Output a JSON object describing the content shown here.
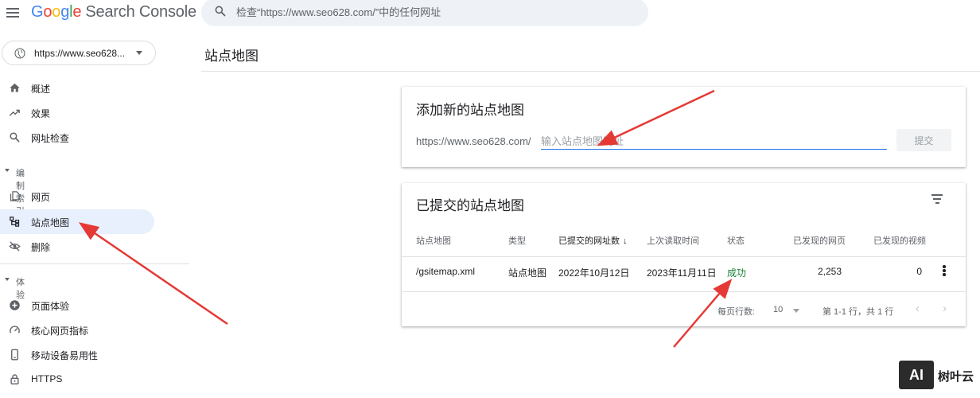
{
  "header": {
    "logo_google_letters": [
      "G",
      "o",
      "o",
      "g",
      "l",
      "e"
    ],
    "logo_product": "Search Console",
    "search_placeholder": "检查“https://www.seo628.com/”中的任何网址"
  },
  "sidebar": {
    "property": "https://www.seo628...",
    "items_top": [
      {
        "label": "概述",
        "icon": "home-icon"
      },
      {
        "label": "效果",
        "icon": "trending-up-icon"
      },
      {
        "label": "网址检查",
        "icon": "search-icon"
      }
    ],
    "section_index": "编制索引",
    "items_index": [
      {
        "label": "网页",
        "icon": "pages-icon"
      },
      {
        "label": "站点地图",
        "icon": "sitemap-icon",
        "active": true
      },
      {
        "label": "删除",
        "icon": "visibility-off-icon"
      }
    ],
    "section_experience": "体验",
    "items_experience": [
      {
        "label": "页面体验",
        "icon": "add-circle-icon"
      },
      {
        "label": "核心网页指标",
        "icon": "speed-icon"
      },
      {
        "label": "移动设备易用性",
        "icon": "smartphone-icon"
      },
      {
        "label": "HTTPS",
        "icon": "lock-icon"
      }
    ]
  },
  "main": {
    "page_title": "站点地图",
    "add_card": {
      "title": "添加新的站点地图",
      "prefix": "https://www.seo628.com/",
      "input_placeholder": "输入站点地图网址",
      "submit_label": "提交"
    },
    "submitted_card": {
      "title": "已提交的站点地图",
      "columns": [
        "站点地图",
        "类型",
        "已提交的网址数",
        "上次读取时间",
        "状态",
        "已发现的网页",
        "已发现的视频"
      ],
      "rows": [
        {
          "sitemap": "/gsitemap.xml",
          "type": "站点地图",
          "submitted": "2022年10月12日",
          "last_read": "2023年11月11日",
          "status": "成功",
          "pages": "2,253",
          "videos": "0"
        }
      ],
      "rows_per_page_label": "每页行数:",
      "rows_per_page_value": "10",
      "range_label": "第 1-1 行，共 1 行"
    }
  },
  "watermark": {
    "logo_text": "AI",
    "text": "树叶云"
  },
  "colors": {
    "accent": "#1a73e8",
    "active_nav": "#e8f0fe",
    "success": "#188038",
    "arrow": "#e53935"
  }
}
